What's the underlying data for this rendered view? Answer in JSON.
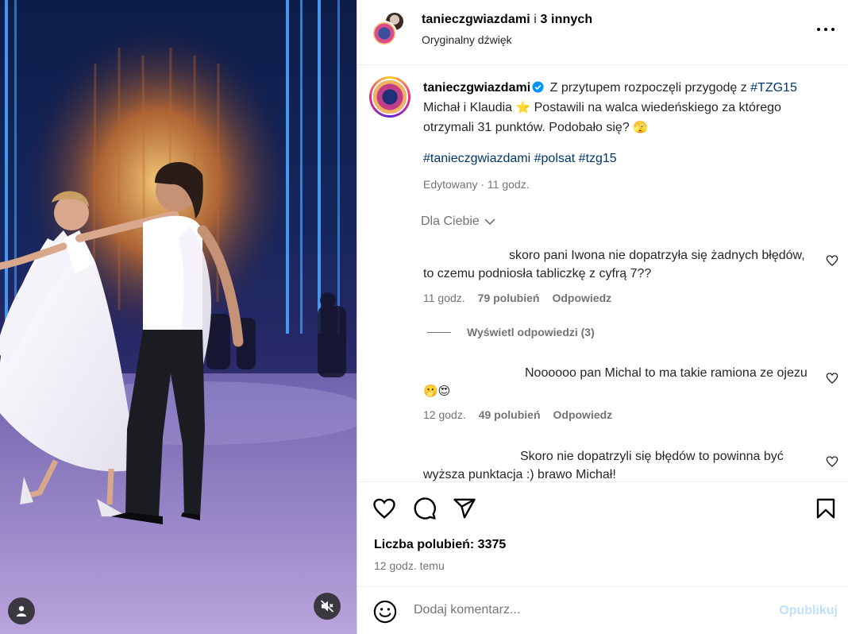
{
  "header": {
    "author": "tanieczgwiazdami",
    "separator": " i ",
    "others": "3 innych",
    "audio": "Oryginalny dźwięk"
  },
  "caption": {
    "username": "tanieczgwiazdami",
    "text_part1": "Z przytupem rozpoczęli przygodę z ",
    "hashtag_inline": "#TZG15",
    "text_part2": " Michał i Klaudia ",
    "emoji_star": "⭐",
    "text_part3": " Postawili na walca wiedeńskiego za którego otrzymali 31 punktów. Podobało się? ",
    "emoji_face": "🫣",
    "hashtags": "#tanieczgwiazdami #polsat #tzg15",
    "edited": "Edytowany · 11 godz."
  },
  "filter": {
    "label": "Dla Ciebie"
  },
  "comments": [
    {
      "text": "skoro pani Iwona nie dopatrzyła się żadnych błędów, to czemu podniosła tabliczkę z cyfrą 7??",
      "time": "11 godz.",
      "likes": "79 polubień",
      "reply": "Odpowiedz",
      "view_replies": "Wyświetl odpowiedzi (3)"
    },
    {
      "text": "Noooooo pan Michal to ma takie ramiona ze ojezu",
      "emoji": "🫢😍",
      "time": "12 godz.",
      "likes": "49 polubień",
      "reply": "Odpowiedz"
    },
    {
      "text": "Skoro nie dopatrzyli się błędów to powinna być wyższa punktacja :) brawo Michał!"
    }
  ],
  "actions": {
    "likes": "Liczba polubień: 3375",
    "time": "12 godz. temu"
  },
  "compose": {
    "placeholder": "Dodaj komentarz...",
    "post": "Opublikuj"
  },
  "colors": {
    "link": "#00376b",
    "meta": "#737373",
    "post_disabled": "#c0dffd",
    "verified": "#0095f6"
  },
  "icons": {
    "media": [
      "user-tag-icon",
      "mute-icon"
    ],
    "actions": [
      "heart-icon",
      "comment-icon",
      "share-icon",
      "bookmark-icon"
    ],
    "compose": [
      "emoji-icon"
    ]
  }
}
